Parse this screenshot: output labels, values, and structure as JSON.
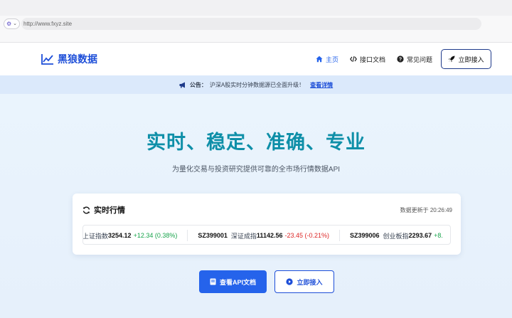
{
  "browser": {
    "url": "http://www.fxyz.site"
  },
  "header": {
    "logo_text": "黑狼数据",
    "nav": [
      {
        "label": "主页",
        "icon": "home-icon",
        "active": true
      },
      {
        "label": "接口文档",
        "icon": "code-icon",
        "active": false
      },
      {
        "label": "常见问题",
        "icon": "question-circle-icon",
        "active": false
      }
    ],
    "cta_label": "立即接入"
  },
  "announcement": {
    "label": "公告：",
    "text": "沪深A股实时分钟数据源已全面升级！",
    "link_label": "查看详情"
  },
  "hero": {
    "title": "实时、稳定、准确、专业",
    "subtitle": "为量化交易与投资研究提供可靠的全市场行情数据API"
  },
  "market": {
    "title": "实时行情",
    "updated": "数据更新于 20:26:49",
    "tickers": [
      {
        "code": "",
        "name": "上证指数",
        "price": "3254.12",
        "change": "+12.34 (0.38%)",
        "direction": "up"
      },
      {
        "code": "SZ399001",
        "name": "深证成指",
        "price": "11142.56",
        "change": "-23.45 (-0.21%)",
        "direction": "down"
      },
      {
        "code": "SZ399006",
        "name": "创业板指",
        "price": "2293.67",
        "change": "+8.",
        "direction": "up"
      }
    ]
  },
  "actions": {
    "primary_label": "查看API文档",
    "secondary_label": "立即接入"
  },
  "colors": {
    "brand": "#1d4ed8",
    "title_teal": "#0e8fa8",
    "up": "#16a34a",
    "down": "#dc2626"
  }
}
